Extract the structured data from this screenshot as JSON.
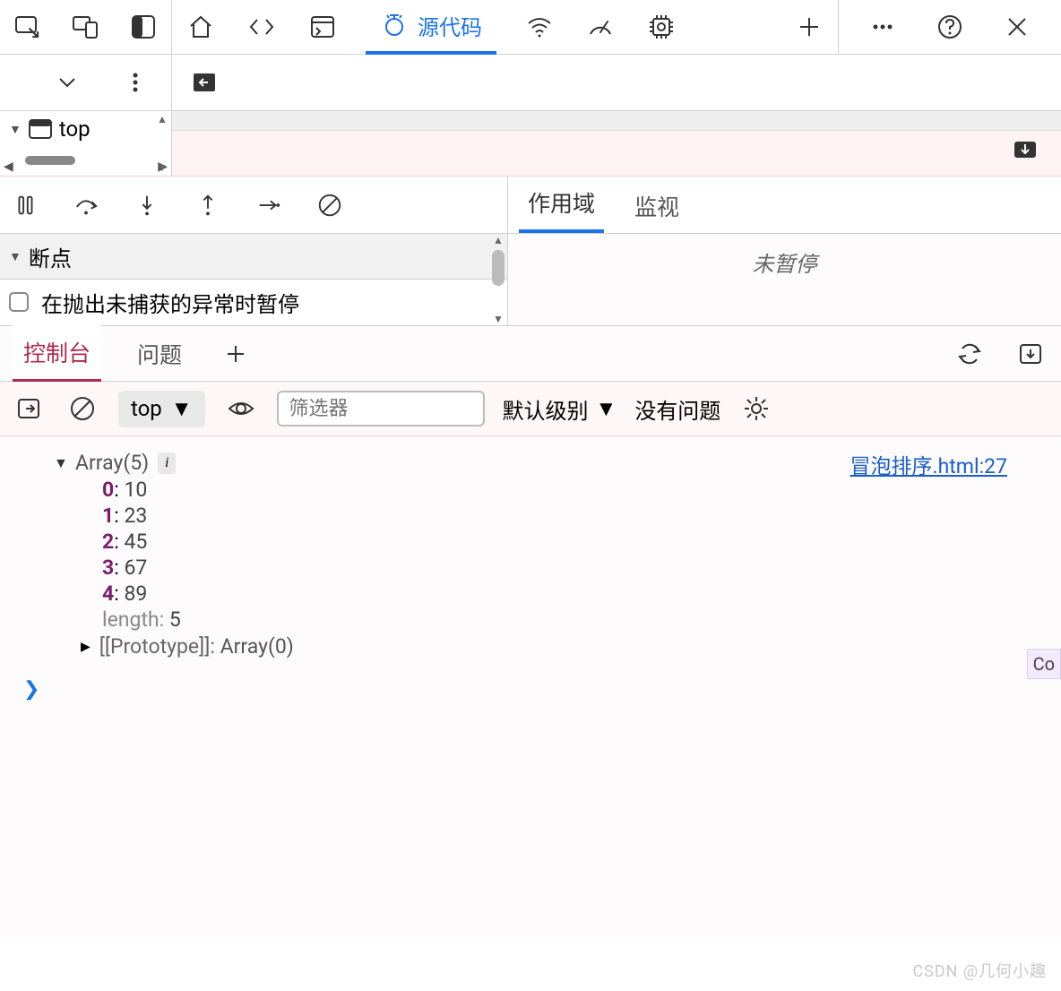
{
  "toolbar": {
    "sources_tab_label": "源代码"
  },
  "navigator": {
    "top_frame_label": "top"
  },
  "debugger": {
    "breakpoints_header": "断点",
    "pause_on_uncaught_label": "在抛出未捕获的异常时暂停",
    "scope_tab_label": "作用域",
    "watch_tab_label": "监视",
    "not_paused_text": "未暂停"
  },
  "drawer": {
    "console_tab_label": "控制台",
    "issues_tab_label": "问题"
  },
  "console_toolbar": {
    "context_label": "top",
    "filter_placeholder": "筛选器",
    "level_label": "默认级别",
    "no_issues_text": "没有问题"
  },
  "console_log": {
    "source_link": "冒泡排序.html:27",
    "array_header": "Array(5)",
    "items": [
      {
        "idx": "0",
        "val": "10"
      },
      {
        "idx": "1",
        "val": "23"
      },
      {
        "idx": "2",
        "val": "45"
      },
      {
        "idx": "3",
        "val": "67"
      },
      {
        "idx": "4",
        "val": "89"
      }
    ],
    "length_label": "length",
    "length_value": "5",
    "prototype_label": "[[Prototype]]",
    "prototype_value": "Array(0)"
  },
  "watermark": "CSDN @几何小趣",
  "side_tag": "Co"
}
